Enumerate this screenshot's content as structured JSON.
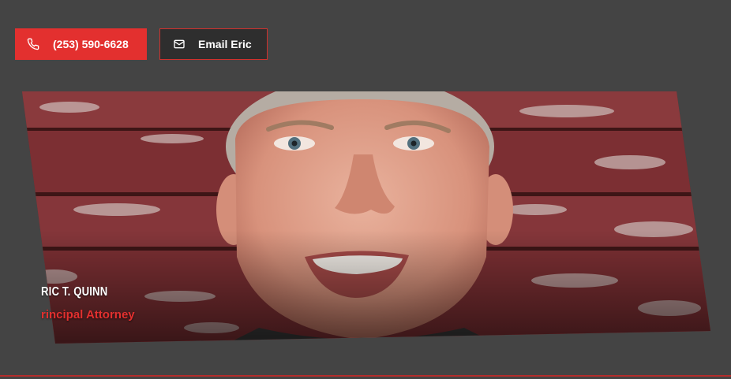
{
  "top_partial_text": "",
  "buttons": {
    "phone_label": "(253) 590-6628",
    "phone_icon": "phone-icon",
    "email_label": "Email Eric",
    "email_icon": "mail-icon"
  },
  "profile": {
    "name": "RIC T. QUINN",
    "title": "rincipal Attorney",
    "photo_alt": "Portrait photo"
  },
  "colors": {
    "background": "#444444",
    "accent": "#e3302f",
    "dark_button": "#2e2e2e"
  }
}
